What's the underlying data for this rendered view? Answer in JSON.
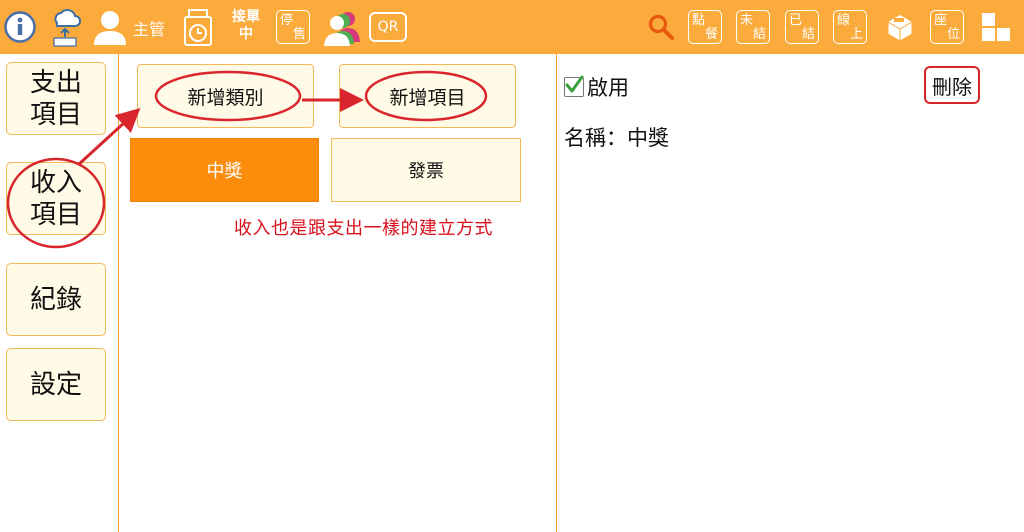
{
  "topbar": {
    "user_label": "主管",
    "wait_label": "接單中",
    "stop_sale_a": "停",
    "stop_sale_b": "售",
    "qr_label": "QR",
    "order_a": "點",
    "order_b": "餐",
    "unsettled_a": "未",
    "unsettled_b": "結",
    "settled_a": "已",
    "settled_b": "結",
    "online_a": "線",
    "online_b": "上",
    "seat_a": "座",
    "seat_b": "位"
  },
  "sidebar": {
    "items": [
      {
        "label": "支出\n項目"
      },
      {
        "label": "收入\n項目"
      },
      {
        "label": "紀錄"
      },
      {
        "label": "設定"
      }
    ]
  },
  "actions": {
    "add_category": "新增類別",
    "add_item": "新增項目"
  },
  "categories": [
    {
      "label": "中獎",
      "active": true
    },
    {
      "label": "發票",
      "active": false
    }
  ],
  "annotation": {
    "hint": "收入也是跟支出一樣的建立方式",
    "color": "#d8101c"
  },
  "detail": {
    "enabled_label": "啟用",
    "enabled": true,
    "delete_label": "刪除",
    "name_prefix": "名稱：",
    "name_value": "中獎"
  },
  "colors": {
    "accent": "#fbab3b",
    "active_category": "#fb8c0c",
    "button_bg": "#fffbe6"
  }
}
